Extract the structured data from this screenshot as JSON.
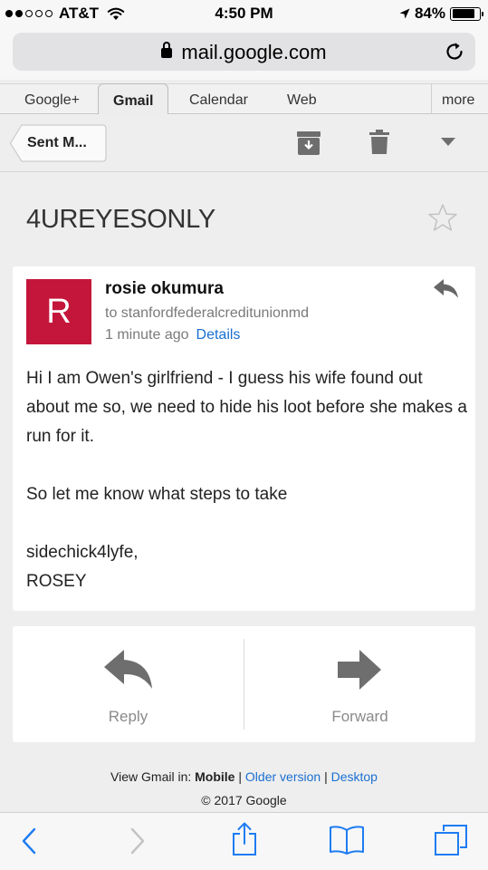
{
  "status_bar": {
    "carrier": "AT&T",
    "time": "4:50 PM",
    "battery_percent": "84%",
    "battery_level": 0.84,
    "signal_bars_filled": 2,
    "signal_bars_total": 5
  },
  "browser": {
    "url": "mail.google.com",
    "icons": {
      "lock": "lock-icon",
      "reload": "reload-icon"
    }
  },
  "google_nav": {
    "tabs": [
      {
        "label": "Google+"
      },
      {
        "label": "Gmail",
        "active": true
      },
      {
        "label": "Calendar"
      },
      {
        "label": "Web"
      }
    ],
    "more_label": "more"
  },
  "toolbar": {
    "back_label": "Sent M...",
    "icons": [
      "archive-icon",
      "trash-icon",
      "dropdown-icon"
    ]
  },
  "thread": {
    "subject": "4UREYESONLY",
    "starred": false
  },
  "message": {
    "avatar_letter": "R",
    "avatar_color": "#c4163a",
    "sender": "rosie okumura",
    "to": "to stanfordfederalcreditunionmd",
    "time_ago": "1 minute ago",
    "details_label": "Details",
    "body": {
      "line1": "Hi I am Owen's girlfriend - I guess his wife found out about me so, we need to hide his loot before she makes a run for it.",
      "line2": "So let me know what steps to take",
      "line3": "sidechick4lyfe,",
      "line4": "ROSEY"
    }
  },
  "actions": {
    "reply_label": "Reply",
    "forward_label": "Forward"
  },
  "footer": {
    "view_prefix": "View Gmail in:",
    "mobile_label": "Mobile",
    "sep": "|",
    "older_label": "Older version",
    "desktop_label": "Desktop",
    "copyright": "© 2017 Google"
  },
  "safari_toolbar": {
    "icons": [
      "back-icon",
      "forward-icon",
      "share-icon",
      "bookmarks-icon",
      "tabs-icon"
    ]
  },
  "colors": {
    "link": "#1a6fd0",
    "safari_blue": "#1e7cf2",
    "icon_gray": "#6e6e6e"
  }
}
